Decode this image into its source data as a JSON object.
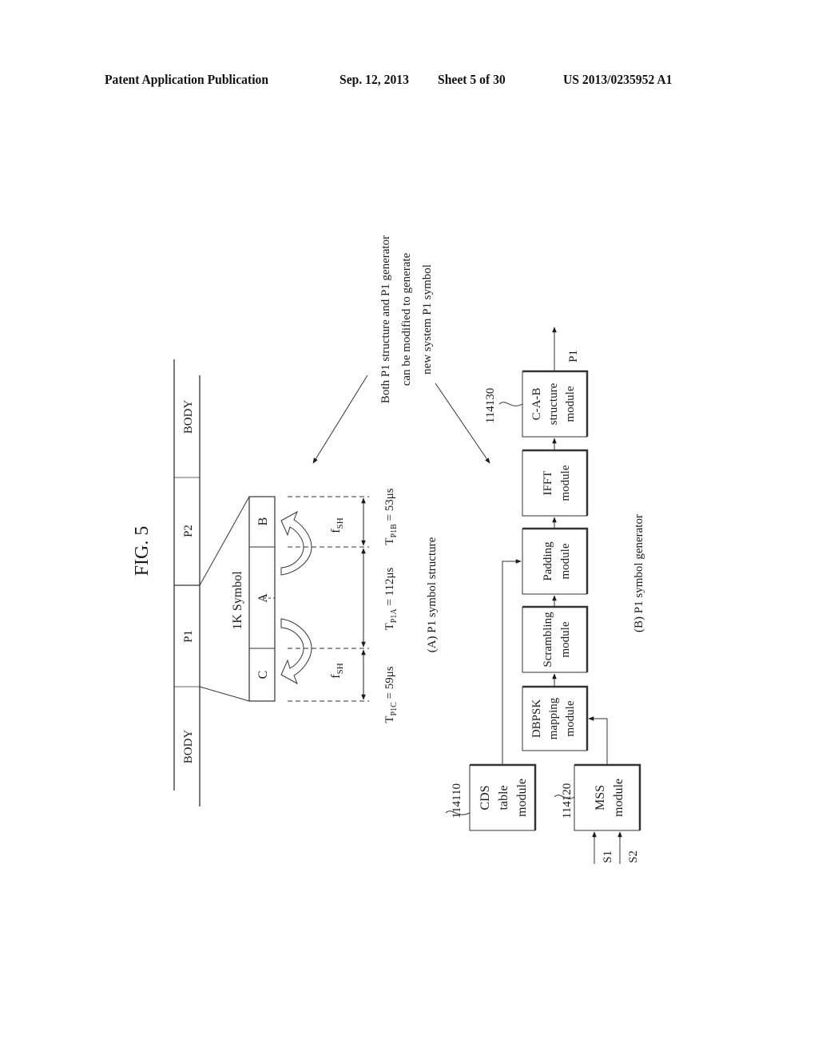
{
  "header": {
    "publication": "Patent Application Publication",
    "date": "Sep. 12, 2013",
    "sheet": "Sheet 5 of 30",
    "patent_number": "US 2013/0235952 A1"
  },
  "figure": {
    "title": "FIG. 5",
    "note_lines": [
      "Both P1 structure and P1 generator",
      "can be modified to generate",
      "new system P1 symbol"
    ],
    "frame": {
      "segments": [
        "BODY",
        "P1",
        "P2",
        "BODY"
      ]
    },
    "symbol": {
      "label": "1K Symbol",
      "parts": [
        "C",
        "A",
        "B"
      ],
      "shift_label": "f",
      "shift_subscript": "SH",
      "timings": [
        {
          "sym": "T",
          "sub": "P1C",
          "value": " = 59μs"
        },
        {
          "sym": "T",
          "sub": "P1A",
          "value": " = 112μs"
        },
        {
          "sym": "T",
          "sub": "P1B",
          "value": " = 53μs"
        }
      ],
      "caption": "(A)  P1 symbol structure"
    },
    "generator": {
      "caption": "(B)  P1 symbol generator",
      "modules": [
        {
          "id": "cds",
          "lines": [
            "CDS",
            "table",
            "module"
          ],
          "ref": "114110"
        },
        {
          "id": "mss",
          "lines": [
            "MSS",
            "module"
          ],
          "ref": "114120"
        },
        {
          "id": "dbpsk",
          "lines": [
            "DBPSK",
            "mapping",
            "module"
          ]
        },
        {
          "id": "scrambling",
          "lines": [
            "Scrambling",
            "module"
          ]
        },
        {
          "id": "padding",
          "lines": [
            "Padding",
            "module"
          ]
        },
        {
          "id": "ifft",
          "lines": [
            "IFFT",
            "module"
          ]
        },
        {
          "id": "cab",
          "lines": [
            "C-A-B",
            "structure",
            "module"
          ],
          "ref": "114130"
        }
      ],
      "inputs": [
        "S1",
        "S2"
      ],
      "output": "P1"
    }
  }
}
